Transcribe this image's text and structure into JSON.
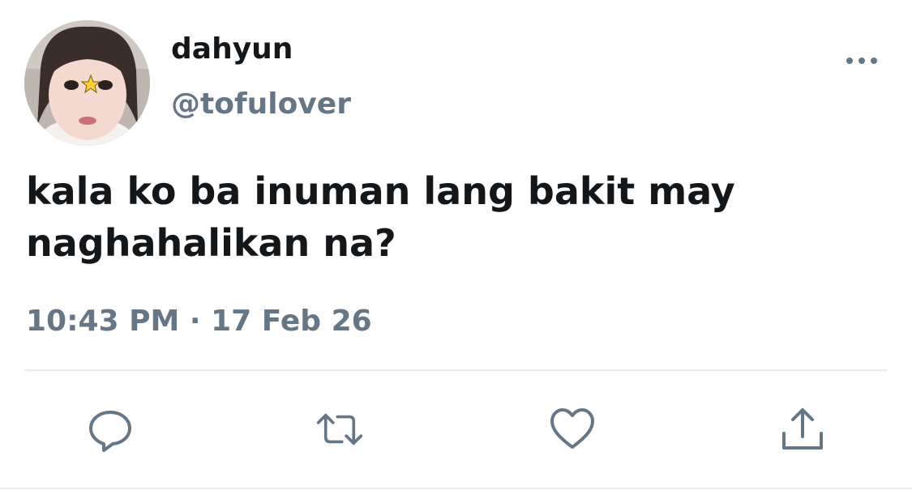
{
  "tweet": {
    "display_name": "dahyun",
    "handle": "@tofulover",
    "text": "kala ko ba inuman lang bakit may naghahalikan na?",
    "time": "10:43 PM",
    "separator": "·",
    "date": "17 Feb 26"
  },
  "icons": {
    "more": "more-horizontal-icon",
    "reply": "reply-icon",
    "retweet": "retweet-icon",
    "like": "heart-icon",
    "share": "share-icon"
  },
  "colors": {
    "text_primary": "#14171a",
    "text_secondary": "#657786",
    "divider": "#e6ecf0"
  }
}
